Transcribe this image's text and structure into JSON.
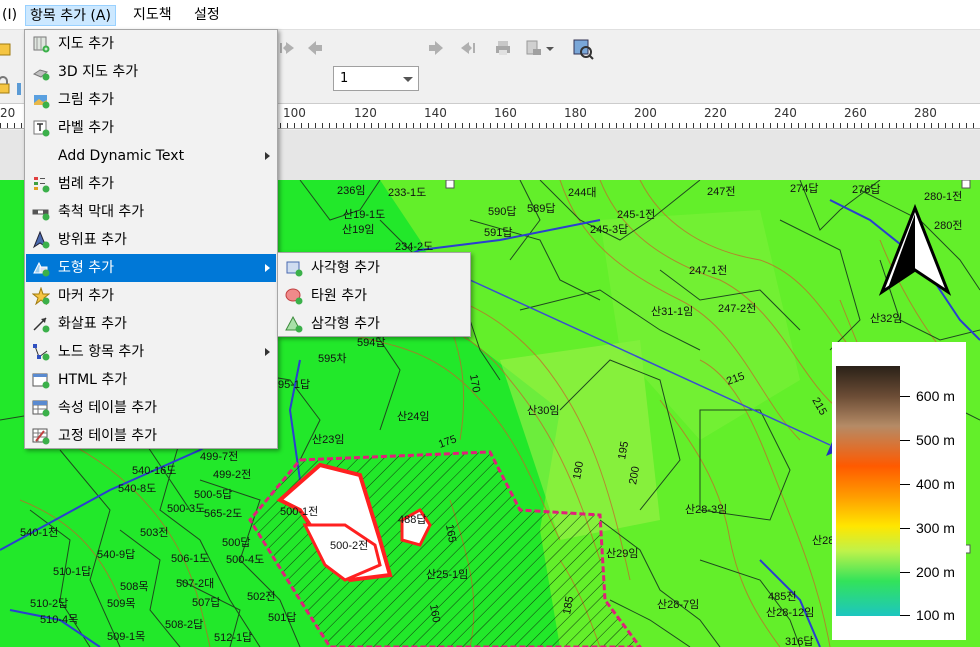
{
  "menubar": {
    "items": [
      {
        "label": "(I)"
      },
      {
        "label": "항목 추가 (A)"
      },
      {
        "label": "지도책"
      },
      {
        "label": "설정"
      }
    ]
  },
  "toolbar": {
    "page_number": "1"
  },
  "ruler": {
    "labels": [
      "20",
      "100",
      "120",
      "140",
      "160",
      "180",
      "200",
      "220",
      "240",
      "260",
      "280"
    ]
  },
  "add_item_menu": {
    "items": [
      {
        "label": "지도 추가",
        "icon": "map-add-icon"
      },
      {
        "label": "3D 지도 추가",
        "icon": "3d-map-add-icon"
      },
      {
        "label": "그림 추가",
        "icon": "picture-add-icon"
      },
      {
        "label": "라벨 추가",
        "icon": "label-add-icon"
      },
      {
        "label": "Add Dynamic Text",
        "icon": "",
        "submenu": true
      },
      {
        "label": "범례 추가",
        "icon": "legend-add-icon"
      },
      {
        "label": "축척 막대 추가",
        "icon": "scalebar-add-icon"
      },
      {
        "label": "방위표 추가",
        "icon": "north-arrow-add-icon"
      },
      {
        "label": "도형 추가",
        "icon": "shape-add-icon",
        "submenu": true,
        "highlighted": true
      },
      {
        "label": "마커 추가",
        "icon": "marker-add-icon"
      },
      {
        "label": "화살표 추가",
        "icon": "arrow-add-icon"
      },
      {
        "label": "노드 항목 추가",
        "icon": "node-item-add-icon",
        "submenu": true
      },
      {
        "label": "HTML 추가",
        "icon": "html-add-icon"
      },
      {
        "label": "속성 테이블 추가",
        "icon": "attribute-table-add-icon"
      },
      {
        "label": "고정 테이블 추가",
        "icon": "fixed-table-add-icon"
      }
    ]
  },
  "shape_submenu": {
    "items": [
      {
        "label": "사각형 추가",
        "icon": "rectangle-add-icon"
      },
      {
        "label": "타원 추가",
        "icon": "ellipse-add-icon"
      },
      {
        "label": "삼각형 추가",
        "icon": "triangle-add-icon"
      }
    ]
  },
  "map": {
    "contour_labels": [
      "170",
      "175",
      "190",
      "195",
      "200",
      "215",
      "215",
      "165",
      "160",
      "185"
    ],
    "parcel_labels": [
      "236임",
      "233-1도",
      "590답",
      "589답",
      "244대",
      "245-1전",
      "247전",
      "274답",
      "276답",
      "280-1전",
      "산19-1도",
      "산19임",
      "591답",
      "234-2도",
      "245-3답",
      "280전",
      "247-1전",
      "산31-1임",
      "247-2전",
      "산32임",
      "594답",
      "595차",
      "95-1답",
      "산24임",
      "산30임",
      "산23임",
      "499-7전",
      "540-16도",
      "499-2전",
      "540-8도",
      "500-5답",
      "500-3도",
      "565-2도",
      "500-1전",
      "500-2전",
      "488답",
      "540-1천",
      "503전",
      "500답",
      "500-4도",
      "540-9답",
      "506-1도",
      "510-1답",
      "507-2대",
      "502전",
      "508목",
      "507답",
      "510-2답",
      "509목",
      "510-4목",
      "501답",
      "508-2답",
      "509-1목",
      "512-1답",
      "산25-1임",
      "산28-3임",
      "산29임",
      "산28",
      "485전",
      "산28-7임",
      "산28-12임",
      "316답"
    ]
  },
  "legend": {
    "labels": [
      "600 m",
      "500 m",
      "400 m",
      "300 m",
      "200 m",
      "100 m"
    ],
    "values": [
      600,
      500,
      400,
      300,
      200,
      100
    ]
  },
  "colors": {
    "terrain_green": "#22e82a",
    "terrain_lime": "#6ef02a",
    "parcel_line": "#1e5a1e",
    "contour": "#c8602a",
    "road_blue": "#2a3fd0",
    "highlight_parcel": "#ff2020",
    "boundary_magenta": "#e0207a",
    "menu_highlight": "#0078d7"
  }
}
